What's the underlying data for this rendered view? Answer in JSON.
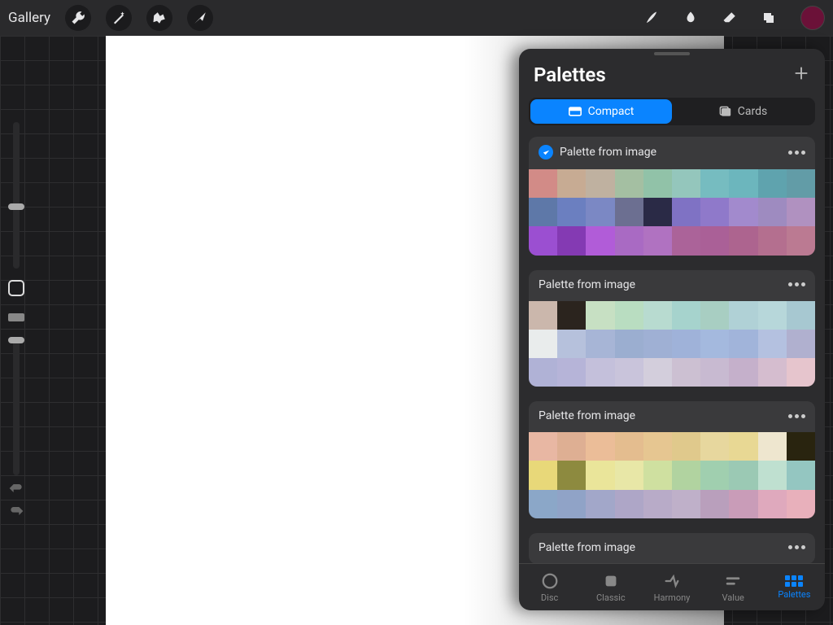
{
  "topbar": {
    "gallery_label": "Gallery"
  },
  "color_circle": "#6b1138",
  "panel": {
    "title": "Palettes",
    "segments": {
      "compact": "Compact",
      "cards": "Cards"
    }
  },
  "palettes": [
    {
      "name": "Palette from image",
      "selected": true,
      "colors": [
        "#d28b87",
        "#c7ab93",
        "#bfb1a0",
        "#a4bfa2",
        "#91c2a8",
        "#94c6bc",
        "#76bcc0",
        "#6cb6bd",
        "#5fa3ae",
        "#629ca7",
        "#5e78a8",
        "#6b7fc0",
        "#7b88c4",
        "#6c6f91",
        "#2a2a46",
        "#7f72c4",
        "#8f79ca",
        "#a28acd",
        "#9e8bc0",
        "#b091c0",
        "#9b4fd1",
        "#843ab3",
        "#b15cd8",
        "#a96ac3",
        "#b072c1",
        "#ab6399",
        "#aa6097",
        "#ad648f",
        "#b46f8f",
        "#bb7a92"
      ]
    },
    {
      "name": "Palette from image",
      "selected": false,
      "colors": [
        "#cbb7ac",
        "#2b241e",
        "#c7e0c3",
        "#b9ddc1",
        "#b8dbd0",
        "#a6d3cd",
        "#a8cec2",
        "#b0d1d6",
        "#b7d7da",
        "#a7c8d1",
        "#e9ecec",
        "#b6c1dc",
        "#a7b5d6",
        "#9baed0",
        "#9fb0d4",
        "#9fb2d9",
        "#a4b9de",
        "#a1b4da",
        "#b4c1e0",
        "#b0b0cf",
        "#b0b2d6",
        "#b6b4d8",
        "#c4c0db",
        "#c9c4db",
        "#d3cedc",
        "#ccc0d2",
        "#c8bad1",
        "#c5b0cb",
        "#d5bdcf",
        "#e6c5cd"
      ]
    },
    {
      "name": "Palette from image",
      "selected": false,
      "colors": [
        "#e8b7a3",
        "#deaf93",
        "#ebbd98",
        "#e4bd8f",
        "#e6c691",
        "#e0c98c",
        "#e7d79e",
        "#e8d894",
        "#eee6cf",
        "#29240f",
        "#e8d879",
        "#8d8a3f",
        "#eae59a",
        "#e8e7a7",
        "#cfe0a0",
        "#b1d3a0",
        "#a0cfaf",
        "#9bc9b4",
        "#bfe0d0",
        "#94c6c1",
        "#8ba7c8",
        "#90a3c7",
        "#a2a7c9",
        "#aea6c7",
        "#b8abc8",
        "#bfb0c9",
        "#b99fbc",
        "#c99cb8",
        "#dfa9bd",
        "#e8b0bb"
      ]
    },
    {
      "name": "Palette from image",
      "selected": false,
      "colors": []
    }
  ],
  "tabs": {
    "disc": "Disc",
    "classic": "Classic",
    "harmony": "Harmony",
    "value": "Value",
    "palettes": "Palettes"
  }
}
